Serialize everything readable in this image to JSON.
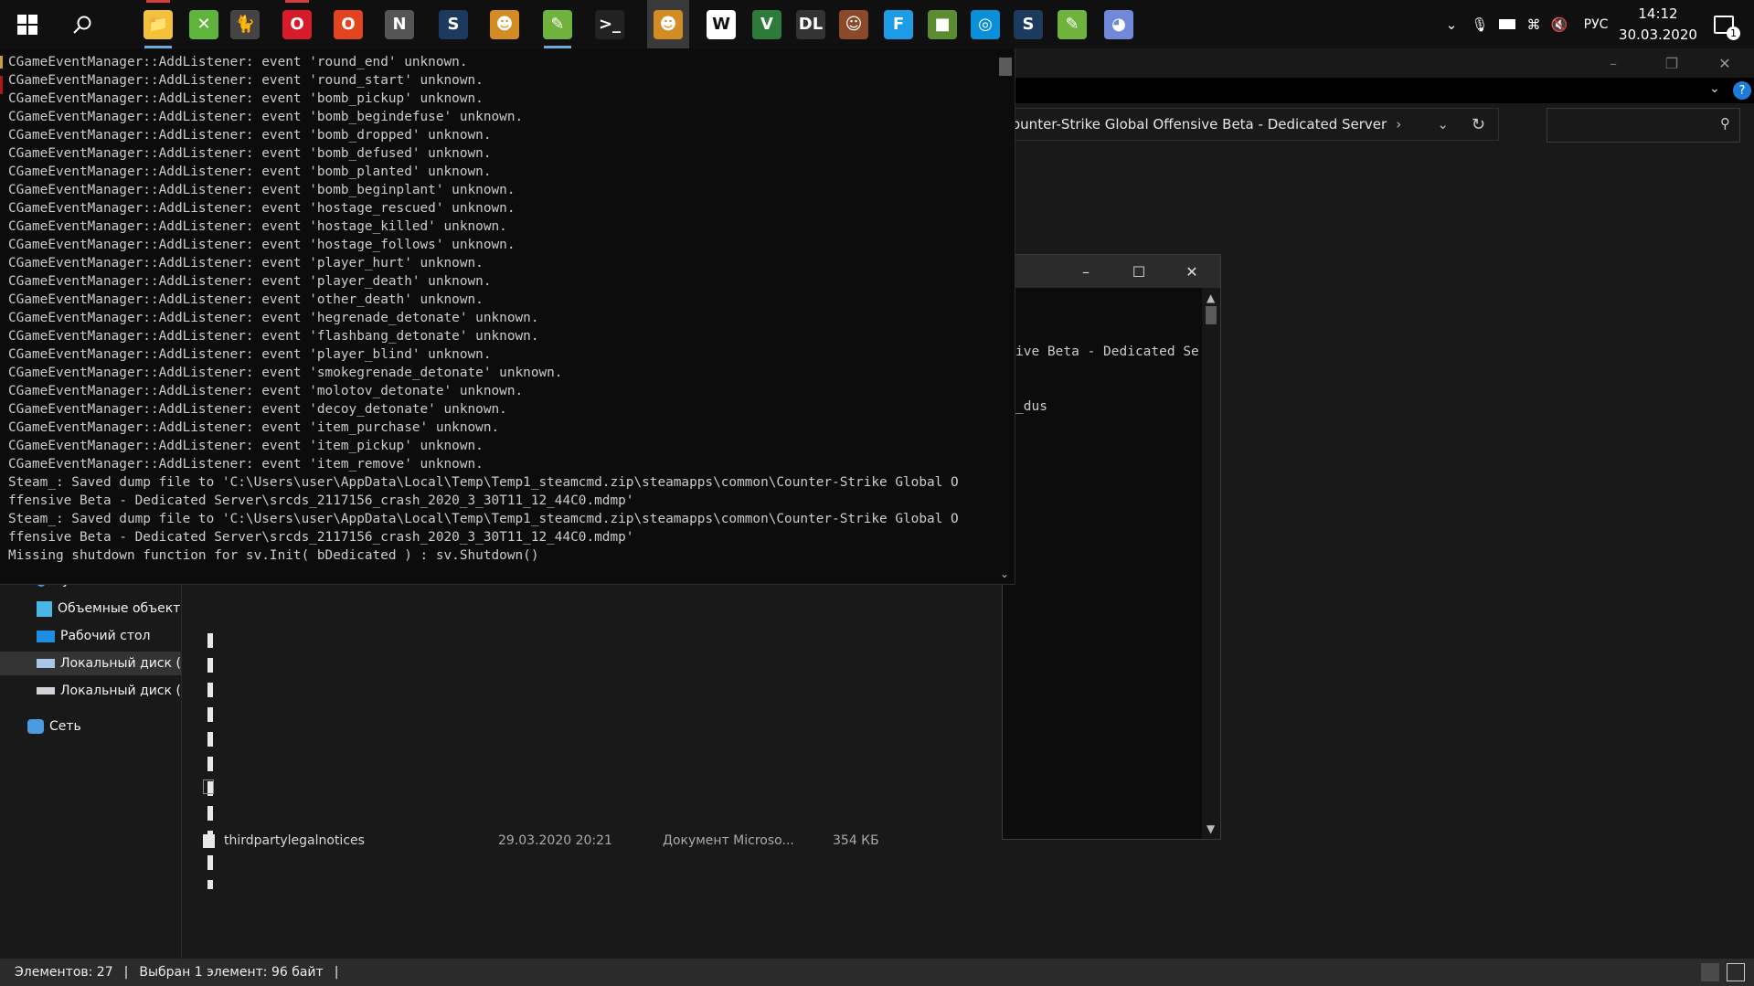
{
  "taskbar": {
    "apps": [
      {
        "name": "File Explorer",
        "glyph": "📁",
        "color": "#f3c13a",
        "running": true
      },
      {
        "name": "Xbox",
        "glyph": "✕",
        "color": "#5fb43c"
      },
      {
        "name": "Cat launcher",
        "glyph": "🐈",
        "color": "#444"
      },
      {
        "name": "Opera",
        "glyph": "O",
        "color": "#d81b2b"
      },
      {
        "name": "Office",
        "glyph": "O",
        "color": "#e2451e"
      },
      {
        "name": "Notion",
        "glyph": "N",
        "color": "#555"
      },
      {
        "name": "Steam",
        "glyph": "S",
        "color": "#1b3a5e"
      },
      {
        "name": "CS:GO",
        "glyph": "☻",
        "color": "#d28c23"
      },
      {
        "name": "Notepad++",
        "glyph": "✎",
        "color": "#6fb33c",
        "running": true
      },
      {
        "name": "Command Prompt",
        "glyph": ">_",
        "color": "#222"
      },
      {
        "name": "CS:GO Dedicated Server",
        "glyph": "☻",
        "color": "#d28c23",
        "active": true
      },
      {
        "name": "Watch Dogs 2",
        "glyph": "W",
        "color": "#fff"
      },
      {
        "name": "GTA V",
        "glyph": "V",
        "color": "#2d7a3a"
      },
      {
        "name": "Dying Light",
        "glyph": "DL",
        "color": "#333"
      },
      {
        "name": "Hotline",
        "glyph": "☺",
        "color": "#8a4a2a"
      },
      {
        "name": "Faceit",
        "glyph": "F",
        "color": "#1e9be6"
      },
      {
        "name": "Minecraft",
        "glyph": "■",
        "color": "#5b8c32"
      },
      {
        "name": "Uplay",
        "glyph": "◎",
        "color": "#0a8fd8"
      },
      {
        "name": "Steam 2",
        "glyph": "S",
        "color": "#1b3a5e"
      },
      {
        "name": "Notepad++ 2",
        "glyph": "✎",
        "color": "#6fb33c"
      },
      {
        "name": "Discord",
        "glyph": "◕",
        "color": "#7289da"
      }
    ],
    "language": "РУС",
    "time": "14:12",
    "date": "30.03.2020",
    "notification_count": "1"
  },
  "explorer": {
    "breadcrumb": "ounter-Strike Global Offensive Beta - Dedicated Server",
    "nav_items": [
      {
        "label": "Музыка",
        "color": "#4a9be0"
      },
      {
        "label": "Объемные объекты",
        "color": "#49b6e8"
      },
      {
        "label": "Рабочий стол",
        "color": "#1e8ee0"
      },
      {
        "label": "Локальный диск (C:",
        "color": "#a8c8e8"
      },
      {
        "label": "Локальный диск (D:",
        "color": "#cfd3d8"
      },
      {
        "label": "Сеть",
        "color": "#4a9be0"
      }
    ],
    "file": {
      "name": "thirdpartylegalnotices",
      "date": "29.03.2020 20:21",
      "type": "Документ Microso...",
      "size": "354 КБ"
    },
    "status": {
      "items_count": "Элементов: 27",
      "selection": "Выбран 1 элемент: 96 байт"
    }
  },
  "console_secondary": {
    "lines": [
      "ive Beta - Dedicated Se",
      "_dus"
    ]
  },
  "console_main": {
    "lines": [
      "CGameEventManager::AddListener: event 'round_end' unknown.",
      "CGameEventManager::AddListener: event 'round_start' unknown.",
      "CGameEventManager::AddListener: event 'bomb_pickup' unknown.",
      "CGameEventManager::AddListener: event 'bomb_begindefuse' unknown.",
      "CGameEventManager::AddListener: event 'bomb_dropped' unknown.",
      "CGameEventManager::AddListener: event 'bomb_defused' unknown.",
      "CGameEventManager::AddListener: event 'bomb_planted' unknown.",
      "CGameEventManager::AddListener: event 'bomb_beginplant' unknown.",
      "CGameEventManager::AddListener: event 'hostage_rescued' unknown.",
      "CGameEventManager::AddListener: event 'hostage_killed' unknown.",
      "CGameEventManager::AddListener: event 'hostage_follows' unknown.",
      "CGameEventManager::AddListener: event 'player_hurt' unknown.",
      "CGameEventManager::AddListener: event 'player_death' unknown.",
      "CGameEventManager::AddListener: event 'other_death' unknown.",
      "CGameEventManager::AddListener: event 'hegrenade_detonate' unknown.",
      "CGameEventManager::AddListener: event 'flashbang_detonate' unknown.",
      "CGameEventManager::AddListener: event 'player_blind' unknown.",
      "CGameEventManager::AddListener: event 'smokegrenade_detonate' unknown.",
      "CGameEventManager::AddListener: event 'molotov_detonate' unknown.",
      "CGameEventManager::AddListener: event 'decoy_detonate' unknown.",
      "CGameEventManager::AddListener: event 'item_purchase' unknown.",
      "CGameEventManager::AddListener: event 'item_pickup' unknown.",
      "CGameEventManager::AddListener: event 'item_remove' unknown.",
      "Steam_: Saved dump file to 'C:\\Users\\user\\AppData\\Local\\Temp\\Temp1_steamcmd.zip\\steamapps\\common\\Counter-Strike Global O",
      "ffensive Beta - Dedicated Server\\srcds_2117156_crash_2020_3_30T11_12_44C0.mdmp'",
      "Steam_: Saved dump file to 'C:\\Users\\user\\AppData\\Local\\Temp\\Temp1_steamcmd.zip\\steamapps\\common\\Counter-Strike Global O",
      "ffensive Beta - Dedicated Server\\srcds_2117156_crash_2020_3_30T11_12_44C0.mdmp'",
      "Missing shutdown function for sv.Init( bDedicated ) : sv.Shutdown()"
    ]
  }
}
